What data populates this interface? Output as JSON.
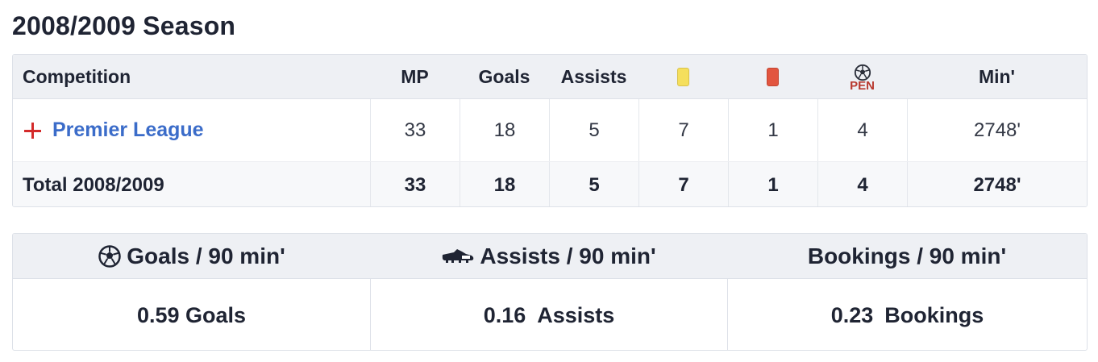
{
  "page": {
    "title": "2008/2009 Season"
  },
  "table": {
    "headers": {
      "competition": "Competition",
      "mp": "MP",
      "goals": "Goals",
      "assists": "Assists",
      "yellow_card_icon": "yellow-card",
      "red_card_icon": "red-card",
      "penalty_label": "PEN",
      "minutes": "Min'"
    },
    "rows": [
      {
        "competition": "Premier League",
        "flag_icon": "england-flag",
        "mp": "33",
        "goals": "18",
        "assists": "5",
        "yellow": "7",
        "red": "1",
        "pen": "4",
        "minutes": "2748'"
      }
    ],
    "total": {
      "label": "Total 2008/2009",
      "mp": "33",
      "goals": "18",
      "assists": "5",
      "yellow": "7",
      "red": "1",
      "pen": "4",
      "minutes": "2748'"
    }
  },
  "per90": {
    "goals": {
      "label": "Goals / 90 min'",
      "icon": "soccer-ball",
      "value": "0.59",
      "unit": "Goals"
    },
    "assists": {
      "label": "Assists / 90 min'",
      "icon": "football-boot",
      "value": "0.16",
      "unit": "Assists"
    },
    "bookings": {
      "label": "Bookings / 90 min'",
      "value": "0.23",
      "unit": "Bookings"
    }
  },
  "colors": {
    "link": "#3b6cc9",
    "header_bg": "#eef0f4",
    "yellow_card": "#f5df5c",
    "red_card": "#e2553f",
    "penalty_text": "#b8392f",
    "flag_red": "#d42a2a"
  }
}
